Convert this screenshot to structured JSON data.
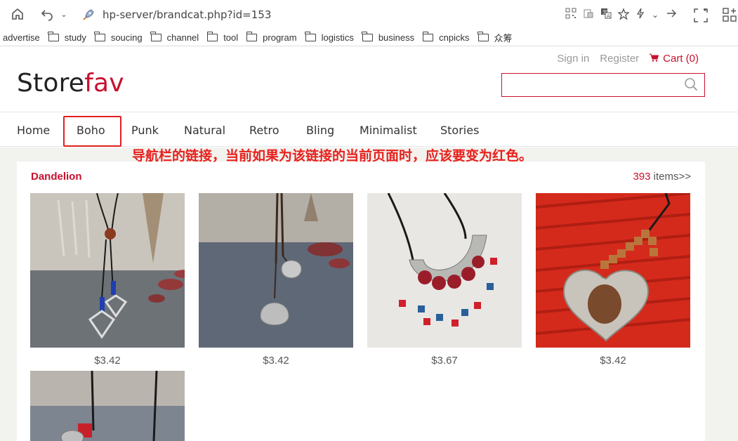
{
  "browser": {
    "url": "hp-server/brandcat.php?id=153",
    "bookmarks": [
      {
        "label": "advertise",
        "folder": false
      },
      {
        "label": "study",
        "folder": true
      },
      {
        "label": "soucing",
        "folder": true
      },
      {
        "label": "channel",
        "folder": true
      },
      {
        "label": "tool",
        "folder": true
      },
      {
        "label": "program",
        "folder": true
      },
      {
        "label": "logistics",
        "folder": true
      },
      {
        "label": "business",
        "folder": true
      },
      {
        "label": "cnpicks",
        "folder": true
      },
      {
        "label": "众筹",
        "folder": true
      }
    ]
  },
  "header": {
    "sign_in": "Sign in",
    "register": "Register",
    "cart": "Cart (0)",
    "logo_part1": "Store",
    "logo_part2": "fav",
    "search_placeholder": ""
  },
  "nav": {
    "items": [
      "Home",
      "Boho",
      "Punk",
      "Natural",
      "Retro",
      "Bling",
      "Minimalist",
      "Stories"
    ],
    "active": "Boho"
  },
  "annotation": "导航栏的链接，当前如果为该链接的当前页面时，应该要变为红色。",
  "panel": {
    "title": "Dandelion",
    "count": "393",
    "count_suffix": " items>>",
    "products": [
      {
        "price": "$3.42",
        "image": "diamond-pendant-necklace"
      },
      {
        "price": "$3.42",
        "image": "silver-flower-bell-necklace"
      },
      {
        "price": "$3.67",
        "image": "bohemian-beaded-bib-necklace"
      },
      {
        "price": "$3.42",
        "image": "heart-pendant-wooden-beads-necklace"
      },
      {
        "price": "",
        "image": "red-bead-pendant-necklace"
      }
    ]
  },
  "colors": {
    "brand_red": "#c8102e",
    "annotation_red": "#e8201c"
  }
}
